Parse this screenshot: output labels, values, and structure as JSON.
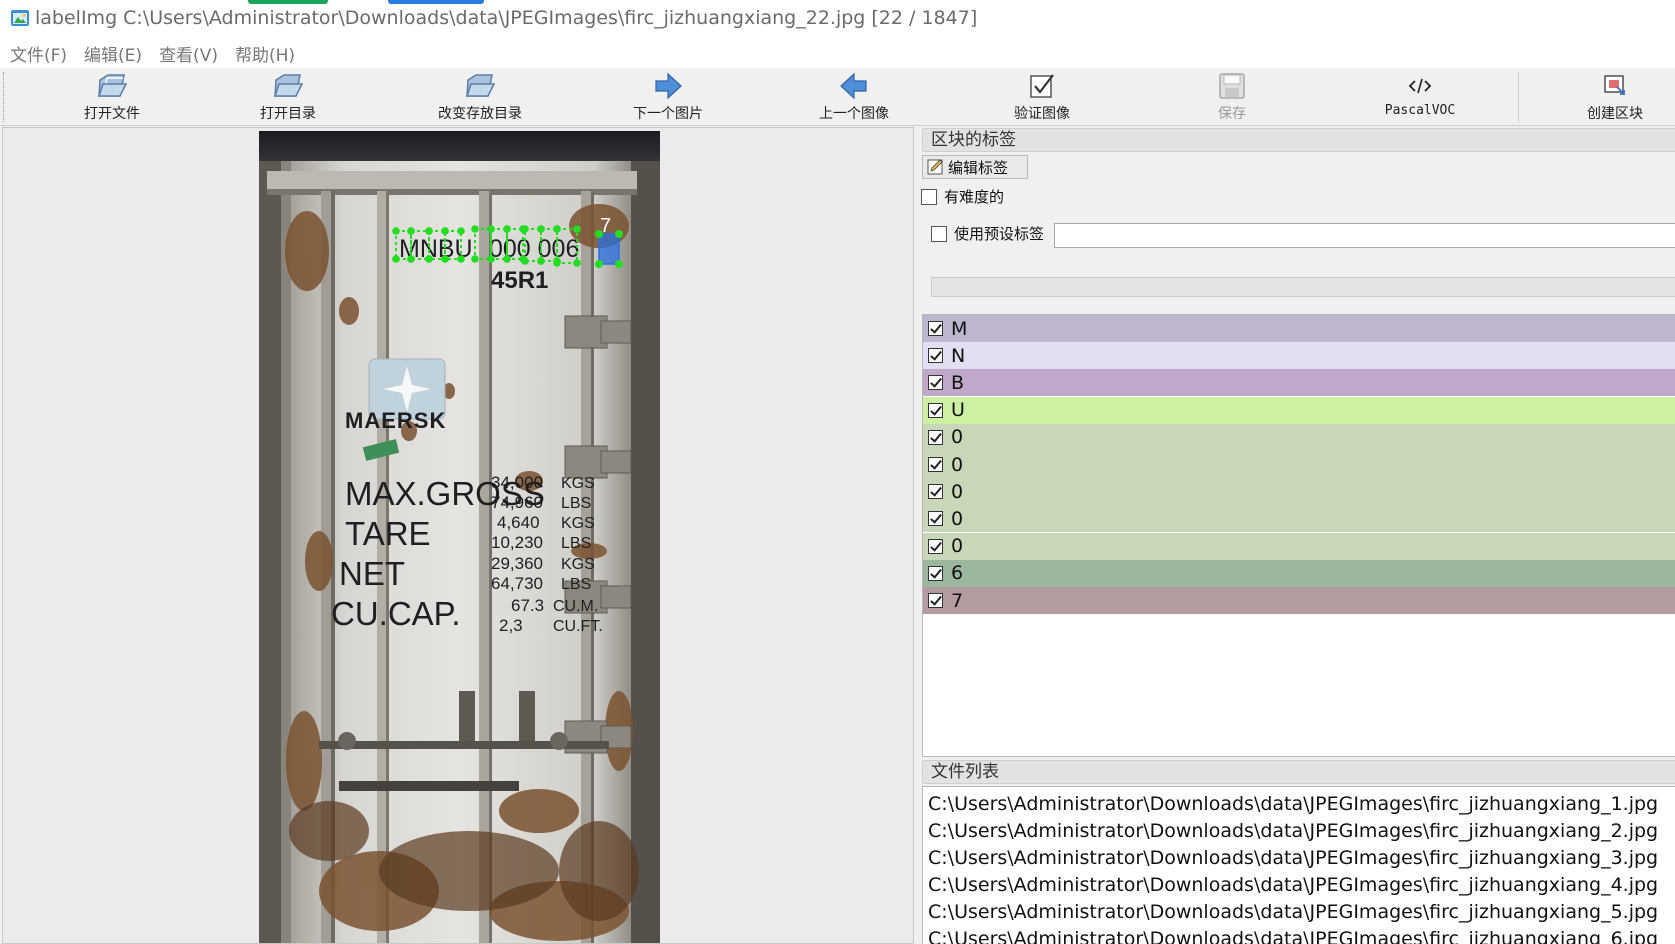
{
  "window": {
    "title": "labelImg C:\\Users\\Administrator\\Downloads\\data\\JPEGImages\\firc_jizhuangxiang_22.jpg [22 / 1847]"
  },
  "menu": {
    "items": [
      {
        "label": "文件(F)"
      },
      {
        "label": "编辑(E)"
      },
      {
        "label": "查看(V)"
      },
      {
        "label": "帮助(H)"
      }
    ]
  },
  "toolbar": {
    "buttons": [
      {
        "label": "打开文件",
        "icon": "open-file-icon",
        "enabled": true
      },
      {
        "label": "打开目录",
        "icon": "open-dir-icon",
        "enabled": true
      },
      {
        "label": "改变存放目录",
        "icon": "change-save-dir-icon",
        "enabled": true
      },
      {
        "label": "下一个图片",
        "icon": "next-arrow-icon",
        "enabled": true
      },
      {
        "label": "上一个图像",
        "icon": "prev-arrow-icon",
        "enabled": true
      },
      {
        "label": "验证图像",
        "icon": "verify-icon",
        "enabled": true
      },
      {
        "label": "保存",
        "icon": "save-icon",
        "enabled": false
      },
      {
        "label": "PascalVOC",
        "icon": "format-code-icon",
        "enabled": true
      },
      {
        "label": "创建区块",
        "icon": "create-rect-icon",
        "enabled": true
      }
    ]
  },
  "canvas": {
    "annotation_label": "7",
    "photo_text": {
      "owner_code": "MNBU",
      "serial": "000 006",
      "type_code": "45R1",
      "brand": "MAERSK",
      "rows": [
        {
          "name": "MAX.GROSS",
          "values": [
            "34,000",
            "74,960"
          ],
          "units": [
            "KGS",
            "LBS"
          ]
        },
        {
          "name": "TARE",
          "values": [
            "4,640",
            "10,230"
          ],
          "units": [
            "KGS",
            "LBS"
          ]
        },
        {
          "name": "NET",
          "values": [
            "29,360",
            "64,730"
          ],
          "units": [
            "KGS",
            "LBS"
          ]
        },
        {
          "name": "CU.CAP.",
          "values": [
            "67.3",
            "2,3"
          ],
          "units": [
            "CU.M.",
            "CU.FT."
          ]
        }
      ]
    }
  },
  "box_labels": {
    "header": "区块的标签",
    "edit_button": "编辑标签",
    "difficult_label": "有难度的",
    "use_default_label": "使用预设标签",
    "default_label_value": "",
    "items": [
      {
        "text": "M",
        "checked": true,
        "color": "#bdb6cd"
      },
      {
        "text": "N",
        "checked": true,
        "color": "#e3dff2"
      },
      {
        "text": "B",
        "checked": true,
        "color": "#c0a8c9"
      },
      {
        "text": "U",
        "checked": true,
        "color": "#cdf0a2"
      },
      {
        "text": "0",
        "checked": true,
        "color": "#c8d6b9"
      },
      {
        "text": "0",
        "checked": true,
        "color": "#c8d6b9"
      },
      {
        "text": "0",
        "checked": true,
        "color": "#c8d6b9"
      },
      {
        "text": "0",
        "checked": true,
        "color": "#c8d6b9"
      },
      {
        "text": "0",
        "checked": true,
        "color": "#c8d6b9"
      },
      {
        "text": "6",
        "checked": true,
        "color": "#9cb79d"
      },
      {
        "text": "7",
        "checked": true,
        "color": "#b39ca0"
      }
    ]
  },
  "file_list": {
    "header": "文件列表",
    "items": [
      "C:\\Users\\Administrator\\Downloads\\data\\JPEGImages\\firc_jizhuangxiang_1.jpg",
      "C:\\Users\\Administrator\\Downloads\\data\\JPEGImages\\firc_jizhuangxiang_2.jpg",
      "C:\\Users\\Administrator\\Downloads\\data\\JPEGImages\\firc_jizhuangxiang_3.jpg",
      "C:\\Users\\Administrator\\Downloads\\data\\JPEGImages\\firc_jizhuangxiang_4.jpg",
      "C:\\Users\\Administrator\\Downloads\\data\\JPEGImages\\firc_jizhuangxiang_5.jpg",
      "C:\\Users\\Administrator\\Downloads\\data\\JPEGImages\\firc_jizhuangxiang_6.jpg"
    ]
  },
  "colors": {
    "annotation_points": "#22dd22",
    "selected_box": "#2a6fe0"
  }
}
